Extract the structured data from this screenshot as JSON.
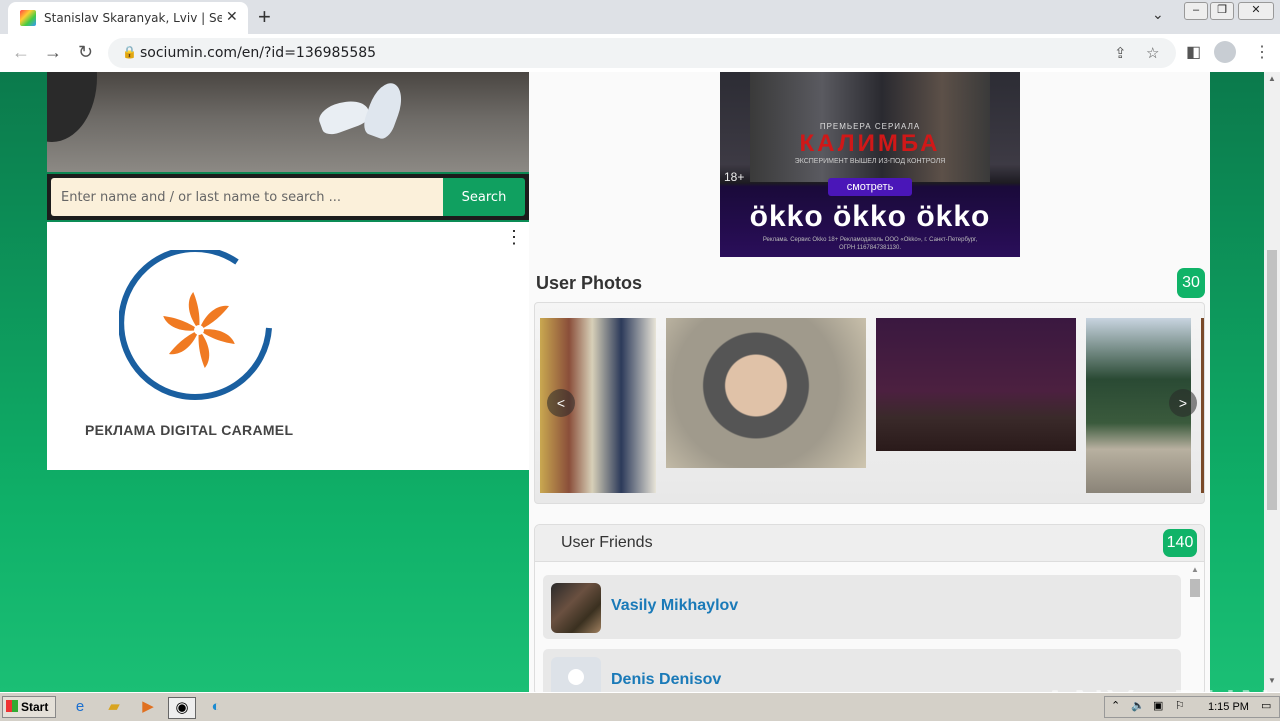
{
  "browser": {
    "tab_title": "Stanislav Skaranyak, Lviv | Search In",
    "url": "sociumin.com/en/?id=136985585"
  },
  "search": {
    "placeholder": "Enter name and / or last name to search ...",
    "button_label": "Search"
  },
  "ad": {
    "caption": "РЕКЛАМА DIGITAL CARAMEL",
    "brand_color": "#1a5fa0",
    "accent_color": "#f07a22"
  },
  "poster": {
    "premiere": "ПРЕМЬЕРА СЕРИАЛА",
    "title": "КАЛИМБА",
    "subtitle": "ЭКСПЕРИМЕНТ ВЫШЕЛ ИЗ-ПОД КОНТРОЛЯ",
    "age": "18+",
    "watch_label": "смотреть",
    "brand": "ökko ökko ökko",
    "legal": "Реклама. Сервис Okko 18+ Рекламодатель ООО «Okko», г. Санкт-Петербург, ОГРН 1167847381130."
  },
  "photos": {
    "title": "User Photos",
    "count": "30",
    "prev_label": "<",
    "next_label": ">"
  },
  "friends": {
    "title": "User Friends",
    "count": "140",
    "items": [
      {
        "name": "Vasily Mikhaylov"
      },
      {
        "name": "Denis Denisov"
      }
    ]
  },
  "watermark": "ANY▷RUN",
  "taskbar": {
    "start_label": "Start",
    "clock": "1:15 PM"
  },
  "colors": {
    "badge": "#10b368",
    "link": "#1a7ab8",
    "search_button": "#10a060"
  }
}
